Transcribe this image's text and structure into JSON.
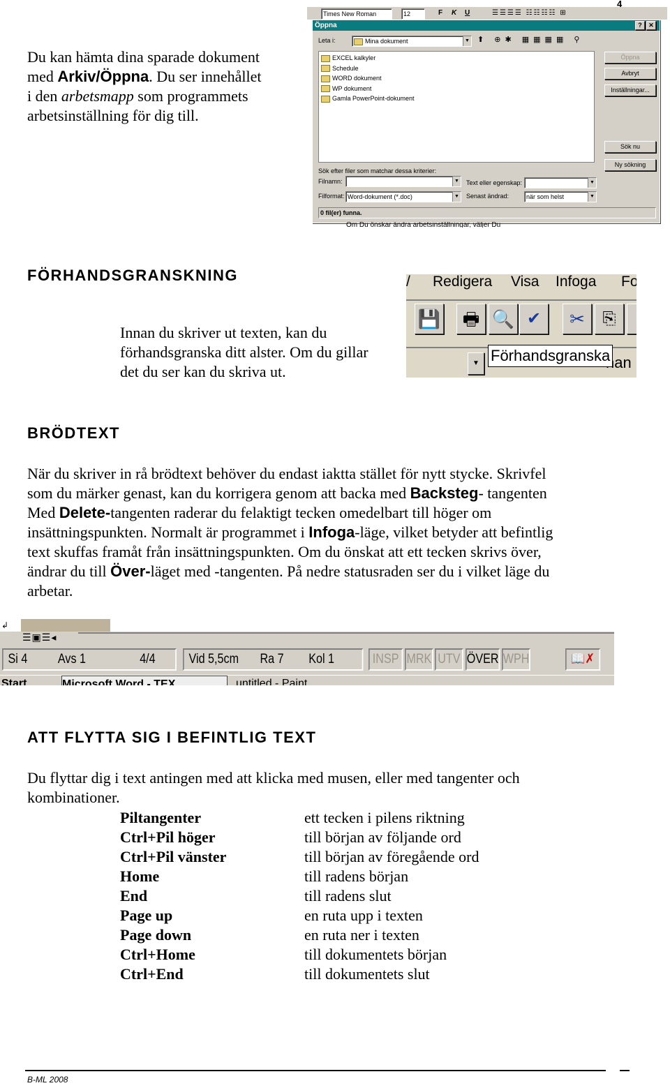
{
  "page_number": "4",
  "intro": {
    "lines": [
      [
        [
          "Du kan hämta dina sparade dokument",
          ""
        ]
      ],
      [
        [
          "med ",
          ""
        ],
        [
          "Arkiv/Öppna",
          "b"
        ],
        [
          ". Du ser innehållet",
          ""
        ]
      ],
      [
        [
          "i den ",
          ""
        ],
        [
          "arbetsmapp",
          "i"
        ],
        [
          " som programmets",
          ""
        ]
      ],
      [
        [
          "arbetsinställning för dig till.",
          ""
        ]
      ]
    ]
  },
  "open_dialog": {
    "toolbar": {
      "font": "Times New Roman",
      "size": "12",
      "bold": "F",
      "italic": "K",
      "underline": "U"
    },
    "title": "Öppna",
    "help": "?",
    "close": "✕",
    "look_in_label": "Leta i:",
    "look_in_value": "Mina dokument",
    "files": [
      "EXCEL kalkyler",
      "Schedule",
      "WORD dokument",
      "WP dokument",
      "Gamla PowerPoint-dokument"
    ],
    "buttons": {
      "open": "Öppna",
      "cancel": "Avbryt",
      "settings": "Inställningar...",
      "search_now": "Sök nu",
      "new_search": "Ny sökning"
    },
    "criteria_label": "Sök efter filer som matchar dessa kriterier:",
    "filename_label": "Filnamn:",
    "filename_value": "",
    "filetype_label": "Filformat:",
    "filetype_value": "Word-dokument (*.doc)",
    "text_label": "Text eller egenskap:",
    "text_value": "",
    "modified_label": "Senast ändrad:",
    "modified_value": "när som helst",
    "status": "0 fil(er) funna.",
    "behind_text": "Om Du önskar ändra arbetsinställningar, väljer Du"
  },
  "preview": {
    "heading": "FÖRHANDSGRANSKNING",
    "lines": [
      [
        [
          "Innan du skriver ut texten, kan du",
          ""
        ]
      ],
      [
        [
          "förhandsgranska ditt alster. Om du gillar",
          ""
        ]
      ],
      [
        [
          "det du ser kan du skriva ut.",
          ""
        ]
      ]
    ],
    "menu": [
      "Redigera",
      "Visa",
      "Infoga",
      "Fo"
    ],
    "tooltip": "Förhandsgranska",
    "behind": "han"
  },
  "body": {
    "heading": "BRÖDTEXT",
    "lines": [
      [
        [
          "När du skriver in rå brödtext behöver du endast iaktta stället för nytt stycke. Skrivfel",
          ""
        ]
      ],
      [
        [
          "som du märker genast, kan du korrigera genom att backa med ",
          ""
        ],
        [
          "Backsteg",
          "b"
        ],
        [
          "- tangenten",
          ""
        ]
      ],
      [
        [
          "Med ",
          ""
        ],
        [
          "Delete-",
          "b"
        ],
        [
          "tangenten raderar du felaktigt tecken omedelbart till höger om",
          ""
        ]
      ],
      [
        [
          "insättningspunkten. Normalt är programmet i ",
          ""
        ],
        [
          "Infoga",
          "b"
        ],
        [
          "-läge, vilket betyder att befintlig",
          ""
        ]
      ],
      [
        [
          "text skuffas framåt från insättningspunkten. Om du önskat att ett tecken skrivs över,",
          ""
        ]
      ],
      [
        [
          "ändrar du till ",
          ""
        ],
        [
          "Över-",
          "b"
        ],
        [
          "läget med -tangenten. På nedre statusraden ser du i vilket läge du",
          ""
        ]
      ],
      [
        [
          "arbetar.",
          ""
        ]
      ]
    ]
  },
  "statusbar": {
    "page": "Si 4",
    "section": "Avs 1",
    "pages": "4/4",
    "position": "Vid 5,5cm",
    "line": "Ra 7",
    "col": "Kol 1",
    "modes": [
      {
        "label": "INSP",
        "active": false
      },
      {
        "label": "MRK",
        "active": false
      },
      {
        "label": "UTV",
        "active": false
      },
      {
        "label": "ÖVER",
        "active": true
      },
      {
        "label": "WPH",
        "active": false
      }
    ],
    "taskbar": [
      "Start",
      "Microsoft Word - TEX",
      "untitled - Paint"
    ]
  },
  "navigate": {
    "heading": "ATT FLYTTA SIG I BEFINTLIG TEXT",
    "lines": [
      [
        [
          "Du flyttar dig i text antingen med att klicka med musen, eller med tangenter och",
          ""
        ]
      ],
      [
        [
          "kombinationer.",
          ""
        ]
      ]
    ],
    "keys": [
      {
        "key": "Piltangenter",
        "desc": "ett tecken i pilens riktning"
      },
      {
        "key": "Ctrl+Pil höger",
        "desc": "till början av följande ord"
      },
      {
        "key": "Ctrl+Pil vänster",
        "desc": "till början av föregående ord"
      },
      {
        "key": "Home",
        "desc": "till radens början"
      },
      {
        "key": "End",
        "desc": "till radens slut"
      },
      {
        "key": "Page up",
        "desc": "en ruta upp i texten"
      },
      {
        "key": "Page down",
        "desc": "en ruta ner i texten"
      },
      {
        "key": "Ctrl+Home",
        "desc": "till dokumentets början"
      },
      {
        "key": "Ctrl+End",
        "desc": "till dokumentets slut"
      }
    ]
  },
  "footer": {
    "text": "B-ML 2008"
  },
  "colors": {
    "titlebar": "#0a7c80",
    "window": "#d4d0c8",
    "screenshot_bg": "#ddd8c8"
  }
}
